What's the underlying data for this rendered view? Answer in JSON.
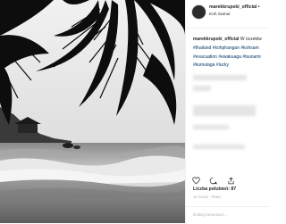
{
  "post": {
    "username": "marekkrupski_official",
    "separator": "•",
    "location": "Koh Samui",
    "caption": {
      "line1_user": "marekkrupski_official",
      "line1_text": "W oczekiw",
      "line2": "#thailand #kohphangan #kohsam",
      "line3": "#evacuation #ewakuaga #tsunami",
      "line4": "#kumulaga #lucky"
    },
    "likes": "Liczba polubień: 87",
    "timestamp": "15 GODZ. TEMU",
    "comment_placeholder": "Dodaj komentarz..."
  },
  "icons": [
    "heart-icon",
    "comment-icon",
    "share-icon"
  ],
  "colors": {
    "hashtag": "#003569",
    "text": "#262626",
    "muted": "#999999"
  }
}
